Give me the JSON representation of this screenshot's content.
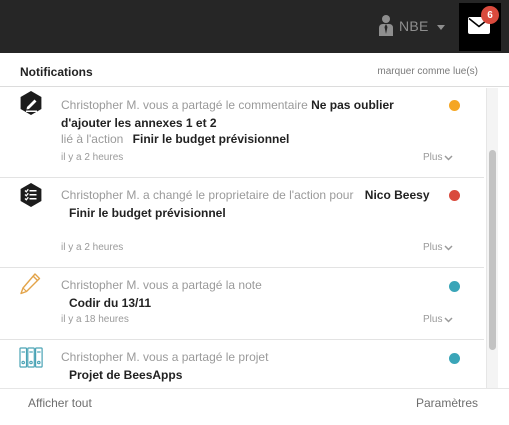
{
  "topbar": {
    "user_name": "NBE",
    "notification_count": "6",
    "icons": [
      "user-icon",
      "caret-down-icon",
      "envelope-icon"
    ]
  },
  "panel": {
    "title": "Notifications",
    "mark_read": "marquer comme lue(s)",
    "show_all": "Afficher tout",
    "settings": "Paramètres"
  },
  "notifications": [
    {
      "icon": "comment-edit-icon",
      "text": "Christopher M. vous a partagé le commentaire",
      "bold": "Ne pas oublier d'ajouter les annexes 1 et 2",
      "link_label": "lié à l'action",
      "link_value": "Finir le budget prévisionnel",
      "time": "il y a 2 heures",
      "more": "Plus",
      "color": "#f5a623"
    },
    {
      "icon": "checklist-icon",
      "text": "Christopher M. a changé le proprietaire de l'action pour",
      "bold": "Nico Beesy",
      "sub": "Finir le budget prévisionnel",
      "time": "il y a 2 heures",
      "more": "Plus",
      "color": "#d94a3d"
    },
    {
      "icon": "pencil-icon",
      "text": "Christopher M. vous a partagé la note",
      "sub": "Codir du 13/11",
      "time": "il y a 18 heures",
      "more": "Plus",
      "color": "#3aa5b8"
    },
    {
      "icon": "binders-icon",
      "text": "Christopher M. vous a partagé le projet",
      "sub": "Projet de BeesApps",
      "color": "#3aa5b8"
    }
  ]
}
